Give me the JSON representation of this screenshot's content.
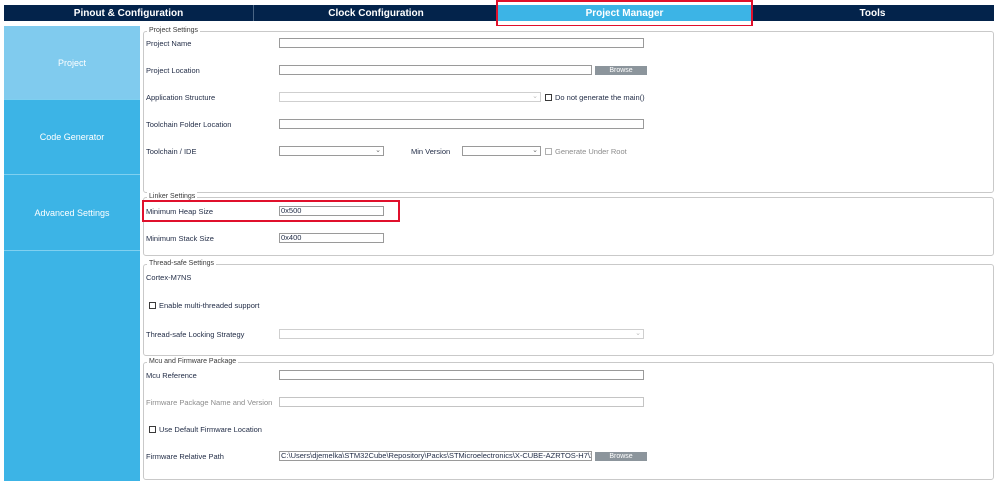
{
  "tabs": [
    {
      "label": "Pinout & Configuration"
    },
    {
      "label": "Clock Configuration"
    },
    {
      "label": "Project Manager"
    },
    {
      "label": "Tools"
    }
  ],
  "sidebar": {
    "items": [
      {
        "label": "Project"
      },
      {
        "label": "Code Generator"
      },
      {
        "label": "Advanced Settings"
      }
    ]
  },
  "project_settings": {
    "legend": "Project Settings",
    "project_name_label": "Project Name",
    "project_name_value": "",
    "project_location_label": "Project Location",
    "project_location_value": "",
    "browse_label": "Browse",
    "application_structure_label": "Application Structure",
    "application_structure_value": "",
    "do_not_generate_main_label": "Do not generate the main()",
    "toolchain_folder_label": "Toolchain Folder Location",
    "toolchain_folder_value": "",
    "toolchain_ide_label": "Toolchain / IDE",
    "toolchain_ide_value": "",
    "min_version_label": "Min Version",
    "min_version_value": "",
    "generate_under_root_label": "Generate Under Root"
  },
  "linker_settings": {
    "legend": "Linker Settings",
    "min_heap_label": "Minimum Heap Size",
    "min_heap_value": "0x500",
    "min_stack_label": "Minimum Stack Size",
    "min_stack_value": "0x400"
  },
  "thread_safe_settings": {
    "legend": "Thread-safe Settings",
    "core_label": "Cortex-M7NS",
    "enable_multithreaded_label": "Enable multi-threaded support",
    "locking_strategy_label": "Thread-safe Locking Strategy",
    "locking_strategy_value": ""
  },
  "mcu_firmware": {
    "legend": "Mcu and Firmware Package",
    "mcu_reference_label": "Mcu Reference",
    "mcu_reference_value": "",
    "firmware_package_label": "Firmware Package Name and Version",
    "firmware_package_value": "",
    "use_default_location_label": "Use Default Firmware Location",
    "firmware_path_label": "Firmware Relative Path",
    "firmware_path_value": "C:\\Users\\djemelka\\STM32Cube\\Repository\\Packs\\STMicroelectronics\\X-CUBE-AZRTOS-H7\\2.1.0",
    "browse_label": "Browse"
  },
  "icons": {
    "dropdown": "chevron-down-icon",
    "checkbox": "checkbox-icon"
  },
  "colors": {
    "tab_bar": "#03234b",
    "tab_active": "#3cb4e6",
    "sidebar": "#3cb4e6",
    "sidebar_active": "#80cbee",
    "highlight": "#e0102c",
    "browse_button": "#8c959c"
  }
}
